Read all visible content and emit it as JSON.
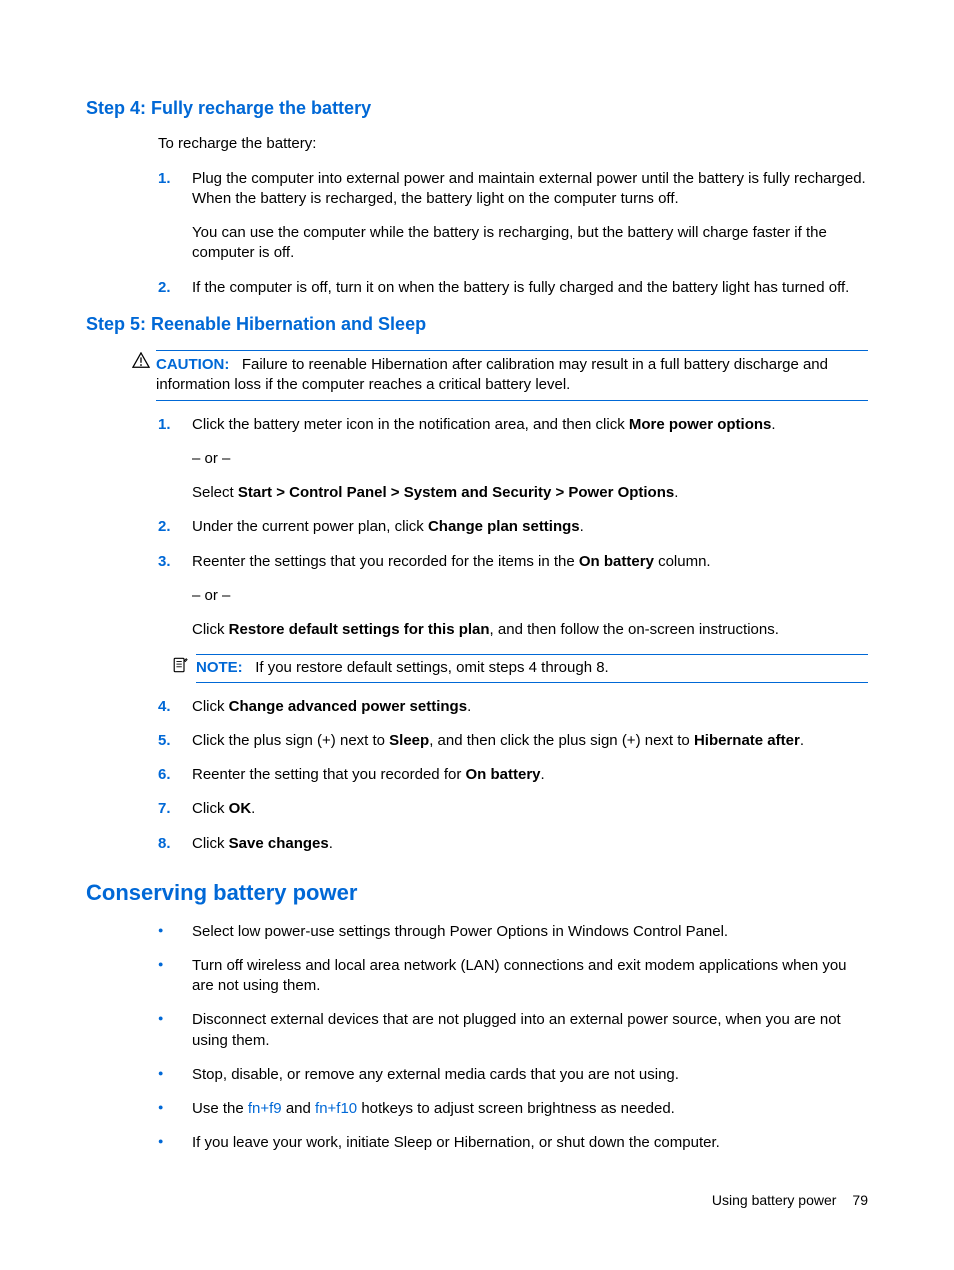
{
  "step4": {
    "heading": "Step 4: Fully recharge the battery",
    "intro": "To recharge the battery:",
    "items": [
      {
        "num": "1.",
        "p1": "Plug the computer into external power and maintain external power until the battery is fully recharged. When the battery is recharged, the battery light on the computer turns off.",
        "p2": "You can use the computer while the battery is recharging, but the battery will charge faster if the computer is off."
      },
      {
        "num": "2.",
        "p1": "If the computer is off, turn it on when the battery is fully charged and the battery light has turned off."
      }
    ]
  },
  "step5": {
    "heading": "Step 5: Reenable Hibernation and Sleep",
    "caution": {
      "label": "CAUTION:",
      "text": "Failure to reenable Hibernation after calibration may result in a full battery discharge and information loss if the computer reaches a critical battery level."
    },
    "items": {
      "i1": {
        "num": "1.",
        "pre": "Click the battery meter icon in the notification area, and then click ",
        "bold": "More power options",
        "post": ".",
        "or": "– or –",
        "alt_pre": "Select ",
        "alt_bold": "Start > Control Panel > System and Security > Power Options",
        "alt_post": "."
      },
      "i2": {
        "num": "2.",
        "pre": "Under the current power plan, click ",
        "bold": "Change plan settings",
        "post": "."
      },
      "i3": {
        "num": "3.",
        "pre": "Reenter the settings that you recorded for the items in the ",
        "bold": "On battery",
        "post": " column.",
        "or": "– or –",
        "alt_pre": "Click ",
        "alt_bold": "Restore default settings for this plan",
        "alt_post": ", and then follow the on-screen instructions."
      },
      "i4": {
        "num": "4.",
        "pre": "Click ",
        "bold": "Change advanced power settings",
        "post": "."
      },
      "i5": {
        "num": "5.",
        "pre": "Click the plus sign (+) next to ",
        "bold1": "Sleep",
        "mid": ", and then click the plus sign (+) next to ",
        "bold2": "Hibernate after",
        "post": "."
      },
      "i6": {
        "num": "6.",
        "pre": "Reenter the setting that you recorded for ",
        "bold": "On battery",
        "post": "."
      },
      "i7": {
        "num": "7.",
        "pre": "Click ",
        "bold": "OK",
        "post": "."
      },
      "i8": {
        "num": "8.",
        "pre": "Click ",
        "bold": "Save changes",
        "post": "."
      }
    },
    "note": {
      "label": "NOTE:",
      "text": "If you restore default settings, omit steps 4 through 8."
    }
  },
  "conserving": {
    "heading": "Conserving battery power",
    "bullets": [
      "Select low power-use settings through Power Options in Windows Control Panel.",
      "Turn off wireless and local area network (LAN) connections and exit modem applications when you are not using them.",
      "Disconnect external devices that are not plugged into an external power source, when you are not using them.",
      "Stop, disable, or remove any external media cards that you are not using."
    ],
    "hotkey": {
      "pre": "Use the ",
      "k1": "fn+f9",
      "mid": " and ",
      "k2": "fn+f10",
      "post": " hotkeys to adjust screen brightness as needed."
    },
    "last": "If you leave your work, initiate Sleep or Hibernation, or shut down the computer."
  },
  "footer": {
    "section": "Using battery power",
    "page": "79"
  }
}
